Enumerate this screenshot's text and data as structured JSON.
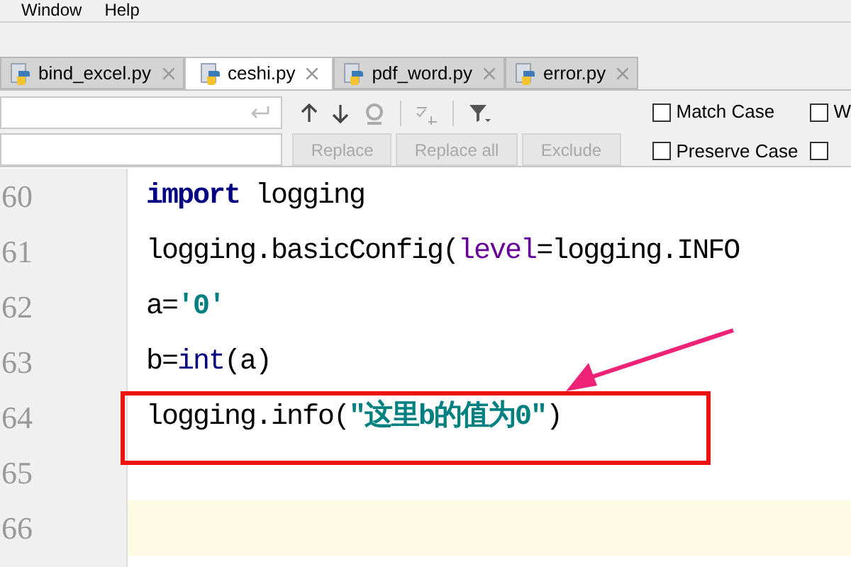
{
  "menu_bar": {
    "items": [
      "Window",
      "Help"
    ]
  },
  "tabs": [
    {
      "label": "bind_excel.py",
      "selected": false
    },
    {
      "label": "ceshi.py",
      "selected": true
    },
    {
      "label": "pdf_word.py",
      "selected": false
    },
    {
      "label": "error.py",
      "selected": false
    }
  ],
  "find_bar": {
    "buttons": [
      {
        "label": "Replace",
        "disabled": true
      },
      {
        "label": "Replace all",
        "disabled": true
      },
      {
        "label": "Exclude",
        "disabled": true
      }
    ],
    "options": [
      {
        "label": "Match Case",
        "checked": false
      },
      {
        "label": "W",
        "checked": false
      },
      {
        "label": "Preserve Case",
        "checked": false
      },
      {
        "checked": false
      }
    ]
  },
  "editor": {
    "lines": [
      {
        "number": "60",
        "highlighted": false,
        "tokens": [
          {
            "kind": "keyword",
            "text": "import"
          },
          {
            "kind": "plain",
            "text": " logging"
          }
        ]
      },
      {
        "number": "61",
        "highlighted": false,
        "tokens": [
          {
            "kind": "plain",
            "text": "logging.basicConfig("
          },
          {
            "kind": "param",
            "text": "level"
          },
          {
            "kind": "plain",
            "text": "=logging.INFO"
          }
        ]
      },
      {
        "number": "62",
        "highlighted": false,
        "tokens": [
          {
            "kind": "plain",
            "text": "a="
          },
          {
            "kind": "string",
            "text": "'0'"
          }
        ]
      },
      {
        "number": "63",
        "highlighted": false,
        "tokens": [
          {
            "kind": "plain",
            "text": "b="
          },
          {
            "kind": "builtin",
            "text": "int"
          },
          {
            "kind": "plain",
            "text": "(a)"
          }
        ]
      },
      {
        "number": "64",
        "highlighted": false,
        "tokens": [
          {
            "kind": "plain",
            "text": "logging.info("
          },
          {
            "kind": "string",
            "text": "\"这里b的值为0\""
          },
          {
            "kind": "plain",
            "text": ")"
          }
        ]
      },
      {
        "number": "65",
        "highlighted": false
      },
      {
        "number": "66",
        "highlighted": true
      }
    ]
  }
}
